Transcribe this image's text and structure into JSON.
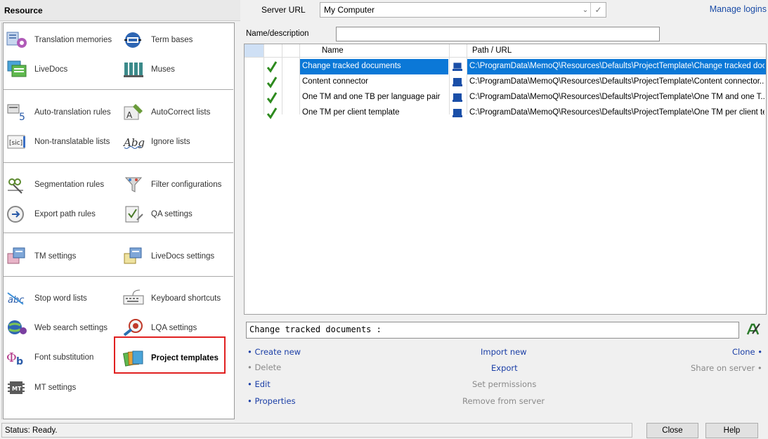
{
  "resource_panel": {
    "title": "Resource",
    "items": [
      {
        "label": "Translation memories",
        "icon": "translation-memories-icon"
      },
      {
        "label": "Term bases",
        "icon": "term-bases-icon"
      },
      {
        "label": "LiveDocs",
        "icon": "livedocs-icon"
      },
      {
        "label": "Muses",
        "icon": "muses-icon"
      },
      {
        "label": "Auto-translation rules",
        "icon": "auto-translation-rules-icon"
      },
      {
        "label": "AutoCorrect lists",
        "icon": "autocorrect-lists-icon"
      },
      {
        "label": "Non-translatable lists",
        "icon": "non-translatable-lists-icon"
      },
      {
        "label": "Ignore lists",
        "icon": "ignore-lists-icon"
      },
      {
        "label": "Segmentation rules",
        "icon": "segmentation-rules-icon"
      },
      {
        "label": "Filter configurations",
        "icon": "filter-configurations-icon"
      },
      {
        "label": "Export path rules",
        "icon": "export-path-rules-icon"
      },
      {
        "label": "QA settings",
        "icon": "qa-settings-icon"
      },
      {
        "label": "TM settings",
        "icon": "tm-settings-icon"
      },
      {
        "label": "LiveDocs settings",
        "icon": "livedocs-settings-icon"
      },
      {
        "label": "Stop word lists",
        "icon": "stop-word-lists-icon"
      },
      {
        "label": "Keyboard shortcuts",
        "icon": "keyboard-shortcuts-icon"
      },
      {
        "label": "Web search settings",
        "icon": "web-search-settings-icon"
      },
      {
        "label": "LQA settings",
        "icon": "lqa-settings-icon"
      },
      {
        "label": "Font substitution",
        "icon": "font-substitution-icon"
      },
      {
        "label": "Project templates",
        "icon": "project-templates-icon"
      },
      {
        "label": "MT settings",
        "icon": "mt-settings-icon"
      }
    ]
  },
  "server": {
    "label": "Server URL",
    "value": "My Computer",
    "manage_logins": "Manage logins"
  },
  "filter": {
    "label": "Name/description",
    "value": ""
  },
  "grid": {
    "columns": [
      "Name",
      "Path / URL"
    ],
    "rows": [
      {
        "name": "Change tracked documents",
        "path": "C:\\ProgramData\\MemoQ\\Resources\\Defaults\\ProjectTemplate\\Change tracked doc...",
        "selected": true
      },
      {
        "name": "Content connector",
        "path": "C:\\ProgramData\\MemoQ\\Resources\\Defaults\\ProjectTemplate\\Content connector....",
        "selected": false
      },
      {
        "name": "One TM and one TB per language pair",
        "path": "C:\\ProgramData\\MemoQ\\Resources\\Defaults\\ProjectTemplate\\One TM and one T...",
        "selected": false
      },
      {
        "name": "One TM per client template",
        "path": "C:\\ProgramData\\MemoQ\\Resources\\Defaults\\ProjectTemplate\\One TM per client te...",
        "selected": false
      }
    ]
  },
  "description": "Change tracked documents :",
  "actions": {
    "create_new": "• Create new",
    "delete": "• Delete",
    "edit": "• Edit",
    "properties": "• Properties",
    "import_new": "Import new",
    "export": "Export",
    "set_permissions": "Set permissions",
    "remove_from_server": "Remove from server",
    "clone": "Clone •",
    "share_on_server": "Share on server •"
  },
  "status": "Status: Ready.",
  "buttons": {
    "close": "Close",
    "help": "Help"
  },
  "colors": {
    "selection": "#0b78d7",
    "link": "#1a3ea6",
    "highlight_box": "#e02020"
  }
}
